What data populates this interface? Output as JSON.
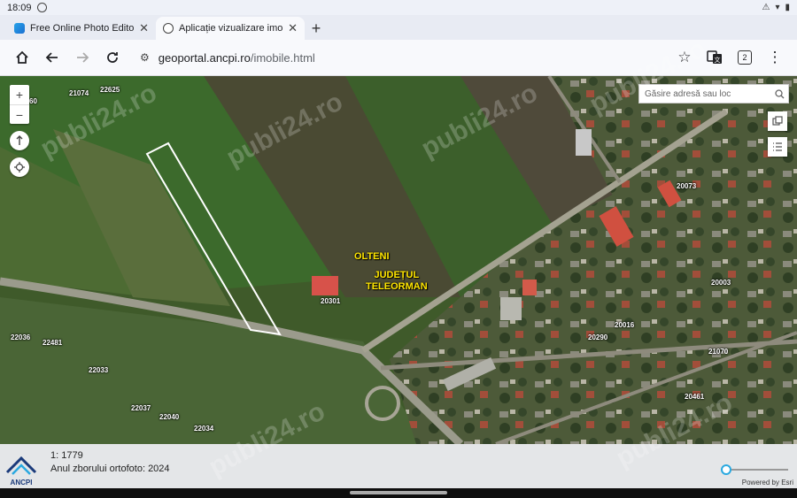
{
  "status_bar": {
    "time": "18:09"
  },
  "tabs": [
    {
      "title": "Free Online Photo Editor: Fr",
      "active": false
    },
    {
      "title": "Aplicație vizualizare imobile",
      "active": true
    }
  ],
  "toolbar": {
    "url_host": "geoportal.ancpi.ro",
    "url_path": "/imobile.html",
    "tab_count": "2"
  },
  "map": {
    "search_placeholder": "Găsire adresă sau loc",
    "parcels": [
      {
        "id": "p1",
        "label": "60"
      },
      {
        "id": "p2",
        "label": "21074"
      },
      {
        "id": "p3",
        "label": "22625"
      },
      {
        "id": "p4",
        "label": "20073"
      },
      {
        "id": "p5",
        "label": "20301"
      },
      {
        "id": "p6",
        "label": "20003"
      },
      {
        "id": "p7",
        "label": "22036"
      },
      {
        "id": "p8",
        "label": "22481"
      },
      {
        "id": "p9",
        "label": "20290"
      },
      {
        "id": "p10",
        "label": "20016"
      },
      {
        "id": "p11",
        "label": "21070"
      },
      {
        "id": "p12",
        "label": "22033"
      },
      {
        "id": "p13",
        "label": "22037"
      },
      {
        "id": "p14",
        "label": "22040"
      },
      {
        "id": "p15",
        "label": "22034"
      },
      {
        "id": "p16",
        "label": "20461"
      }
    ],
    "places": {
      "village": "OLTENI",
      "county_line1": "JUDEȚUL",
      "county_line2": "TELEORMAN"
    }
  },
  "footer": {
    "scale": "1: 1779",
    "ortho_year": "Anul zborului ortofoto: 2024",
    "logo_text": "ANCPI",
    "attribution": "Powered by Esri"
  },
  "watermarks": [
    "publi24.ro",
    "publi24.ro",
    "publi24.ro",
    "publi24.ro",
    "publi24.ro",
    "publi24.ro"
  ],
  "colors": {
    "accent": "#2aa9e0",
    "label_yellow": "#ffe600",
    "parcel_outline": "#ffffff"
  },
  "icons": [
    "home-icon",
    "back-icon",
    "forward-icon",
    "reload-icon",
    "tune-icon",
    "star-icon",
    "translate-icon",
    "menu-dots-icon",
    "zoom-in-icon",
    "zoom-out-icon",
    "compass-icon",
    "locate-icon",
    "search-icon",
    "basemap-icon",
    "layers-list-icon"
  ]
}
